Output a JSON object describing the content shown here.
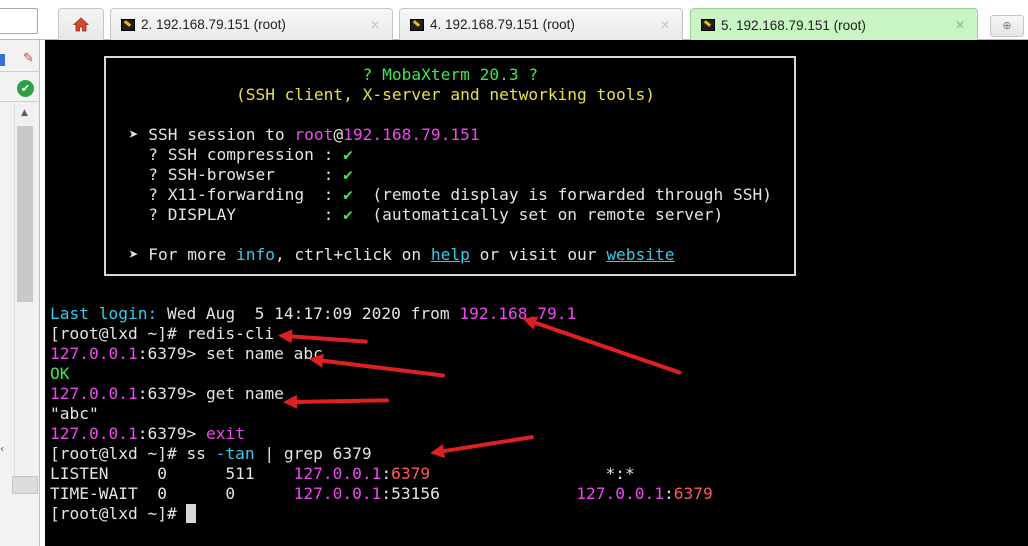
{
  "tabs": [
    {
      "label": "2. 192.168.79.151 (root)",
      "active": false
    },
    {
      "label": "4. 192.168.79.151 (root)",
      "active": false
    },
    {
      "label": "5. 192.168.79.151 (root)",
      "active": true
    }
  ],
  "tab_close_glyph": "✕",
  "new_tab_glyph": "⊕",
  "icons": {
    "home": "home-icon",
    "session": "ssh-key-icon",
    "check": "check-icon",
    "pin": "pin-icon"
  },
  "colors": {
    "active_tab": "#c8f5c3",
    "terminal_bg": "#000000",
    "green": "#3fe650",
    "yellow": "#e8e04a",
    "magenta": "#f048f0",
    "cyan": "#37c9ee",
    "red": "#ff5a5a",
    "annotation_arrow": "#e02020"
  },
  "banner": {
    "lines": [
      [
        {
          "t": "                         "
        },
        {
          "t": "? MobaXterm 20.3 ?",
          "c": "g"
        }
      ],
      [
        {
          "t": "            "
        },
        {
          "t": "(SSH client, X-server and networking tools)",
          "c": "y"
        }
      ],
      [],
      [
        {
          "t": " ➤ SSH session to "
        },
        {
          "t": "root",
          "c": "m"
        },
        {
          "t": "@"
        },
        {
          "t": "192.168.79.151",
          "c": "m"
        }
      ],
      [
        {
          "t": "   ? SSH compression : "
        },
        {
          "t": "✔",
          "c": "g"
        }
      ],
      [
        {
          "t": "   ? SSH-browser     : "
        },
        {
          "t": "✔",
          "c": "g"
        }
      ],
      [
        {
          "t": "   ? X11-forwarding  : "
        },
        {
          "t": "✔",
          "c": "g"
        },
        {
          "t": "  (remote display is forwarded through SSH)"
        }
      ],
      [
        {
          "t": "   ? DISPLAY         : "
        },
        {
          "t": "✔",
          "c": "g"
        },
        {
          "t": "  (automatically set on remote server)"
        }
      ],
      [],
      [
        {
          "t": " ➤ For more "
        },
        {
          "t": "info",
          "c": "c"
        },
        {
          "t": ", ctrl+click on "
        },
        {
          "t": "help",
          "c": "u"
        },
        {
          "t": " or visit our "
        },
        {
          "t": "website",
          "c": "u"
        }
      ]
    ]
  },
  "terminal": {
    "lines": [
      [
        {
          "t": "Last login: ",
          "c": "c"
        },
        {
          "t": "Wed Aug  5 14:17:09 2020 from "
        },
        {
          "t": "192.168.79.1",
          "c": "m"
        }
      ],
      [
        {
          "t": "[root@lxd ~]# redis-cli"
        }
      ],
      [
        {
          "t": "127.0.0.1",
          "c": "m"
        },
        {
          "t": ":6379> set name abc"
        }
      ],
      [
        {
          "t": "OK",
          "c": "g"
        }
      ],
      [
        {
          "t": "127.0.0.1",
          "c": "m"
        },
        {
          "t": ":6379> get name"
        }
      ],
      [
        {
          "t": "\"abc\""
        }
      ],
      [
        {
          "t": "127.0.0.1",
          "c": "m"
        },
        {
          "t": ":6379> "
        },
        {
          "t": "exit",
          "c": "m"
        }
      ],
      [
        {
          "t": "[root@lxd ~]# ss "
        },
        {
          "t": "-tan",
          "c": "c"
        },
        {
          "t": " | grep 6379"
        }
      ],
      [
        {
          "t": "LISTEN     0      511    "
        },
        {
          "t": "127.0.0.1",
          "c": "m"
        },
        {
          "t": ":"
        },
        {
          "t": "6379",
          "c": "r"
        },
        {
          "t": "                  *:*"
        }
      ],
      [
        {
          "t": "TIME-WAIT  0      0      "
        },
        {
          "t": "127.0.0.1",
          "c": "m"
        },
        {
          "t": ":53156              "
        },
        {
          "t": "127.0.0.1",
          "c": "m"
        },
        {
          "t": ":"
        },
        {
          "t": "6379",
          "c": "r"
        }
      ],
      [
        {
          "t": "[root@lxd ~]# "
        },
        {
          "cursor": true
        }
      ]
    ]
  }
}
